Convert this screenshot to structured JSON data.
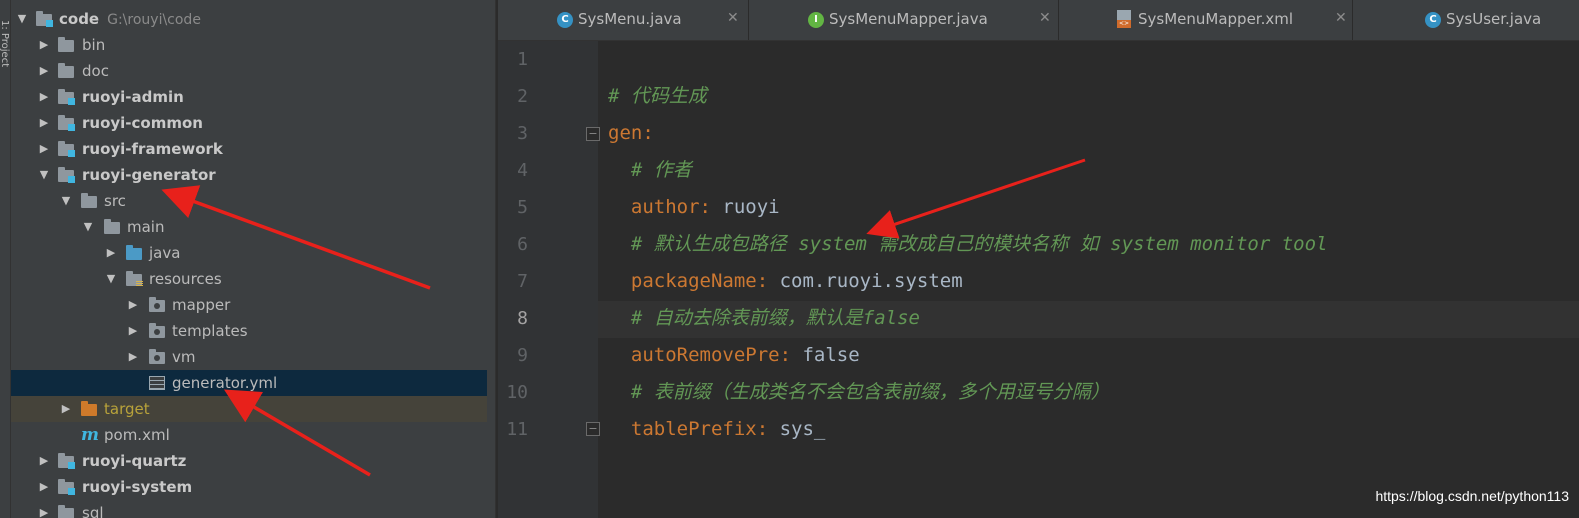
{
  "toolstrip": {
    "label": "1: Project"
  },
  "tree": {
    "rows": [
      {
        "label": "code",
        "sub": "G:\\rouyi\\code"
      },
      {
        "label": "bin"
      },
      {
        "label": "doc"
      },
      {
        "label": "ruoyi-admin"
      },
      {
        "label": "ruoyi-common"
      },
      {
        "label": "ruoyi-framework"
      },
      {
        "label": "ruoyi-generator"
      },
      {
        "label": "src"
      },
      {
        "label": "main"
      },
      {
        "label": "java"
      },
      {
        "label": "resources"
      },
      {
        "label": "mapper"
      },
      {
        "label": "templates"
      },
      {
        "label": "vm"
      },
      {
        "label": "generator.yml"
      },
      {
        "label": "target"
      },
      {
        "label": "pom.xml"
      },
      {
        "label": "ruoyi-quartz"
      },
      {
        "label": "ruoyi-system"
      },
      {
        "label": "sql"
      }
    ]
  },
  "tabs": [
    {
      "label": "SysMenu.java",
      "icon": "C",
      "icon_color": "#3592c4"
    },
    {
      "label": "SysMenuMapper.java",
      "icon": "I",
      "icon_color": "#62b543"
    },
    {
      "label": "SysMenuMapper.xml",
      "icon": "xml-file-icon"
    },
    {
      "label": "SysUser.java",
      "icon": "C",
      "icon_color": "#3592c4"
    }
  ],
  "editor": {
    "current_line": 8,
    "lines": [
      {
        "n": "1",
        "key": "",
        "colon": "",
        "value": "",
        "comment": ""
      },
      {
        "n": "2",
        "key": "",
        "colon": "",
        "value": "",
        "comment": "# 代码生成"
      },
      {
        "n": "3",
        "key": "gen",
        "colon": ":",
        "value": "",
        "comment": ""
      },
      {
        "n": "4",
        "key": "",
        "colon": "",
        "value": "",
        "comment": "  # 作者"
      },
      {
        "n": "5",
        "key": "  author",
        "colon": ":",
        "value": " ruoyi",
        "comment": ""
      },
      {
        "n": "6",
        "key": "",
        "colon": "",
        "value": "",
        "comment": "  # 默认生成包路径 system 需改成自己的模块名称 如 system monitor tool"
      },
      {
        "n": "7",
        "key": "  packageName",
        "colon": ":",
        "value": " com.ruoyi.system",
        "comment": ""
      },
      {
        "n": "8",
        "key": "",
        "colon": "",
        "value": "",
        "comment": "  # 自动去除表前缀，默认是false"
      },
      {
        "n": "9",
        "key": "  autoRemovePre",
        "colon": ":",
        "value": " false",
        "comment": ""
      },
      {
        "n": "10",
        "key": "",
        "colon": "",
        "value": "",
        "comment": "  # 表前缀（生成类名不会包含表前缀，多个用逗号分隔）"
      },
      {
        "n": "11",
        "key": "  tablePrefix",
        "colon": ":",
        "value": " sys_",
        "comment": ""
      }
    ]
  },
  "watermark": "https://blog.csdn.net/python113",
  "colors": {
    "arrow": "#e8211b",
    "selection": "#0d293e",
    "comment": "#629755",
    "key": "#cc7832"
  }
}
